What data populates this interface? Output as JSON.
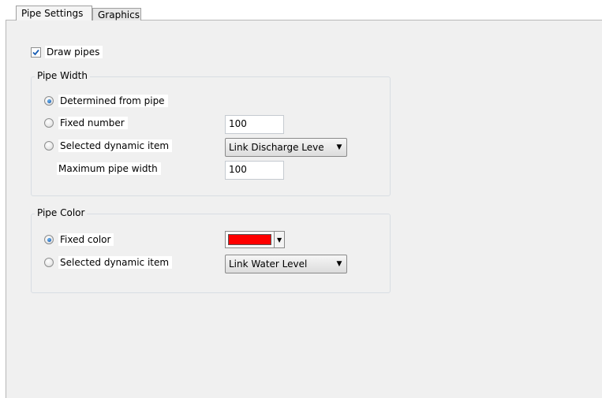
{
  "tabs": [
    {
      "label": "Pipe Settings",
      "active": true
    },
    {
      "label": "Graphics",
      "active": false
    }
  ],
  "draw_pipes": {
    "label": "Draw pipes",
    "checked": true
  },
  "pipe_width": {
    "title": "Pipe Width",
    "options": [
      {
        "label": "Determined from pipe",
        "selected": true
      },
      {
        "label": "Fixed number",
        "selected": false
      },
      {
        "label": "Selected dynamic item",
        "selected": false
      }
    ],
    "fixed_number_value": "100",
    "dynamic_item_value": "Link Discharge Leve",
    "max_width_label": "Maximum pipe width",
    "max_width_value": "100"
  },
  "pipe_color": {
    "title": "Pipe Color",
    "options": [
      {
        "label": "Fixed color",
        "selected": true
      },
      {
        "label": "Selected dynamic item",
        "selected": false
      }
    ],
    "fixed_color": "#ff0000",
    "dynamic_item_value": "Link Water Level"
  },
  "colors": {
    "accent": "#1a5fb4",
    "panel": "#f0f0f0",
    "group_border": "#d8dde3"
  }
}
